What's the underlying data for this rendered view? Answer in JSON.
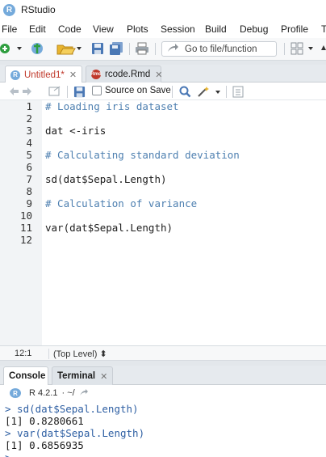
{
  "window": {
    "title": "RStudio",
    "logo_letter": "R"
  },
  "menu": [
    "File",
    "Edit",
    "Code",
    "View",
    "Plots",
    "Session",
    "Build",
    "Debug",
    "Profile",
    "T"
  ],
  "toolbar": {
    "goto_placeholder": "Go to file/function",
    "icons": [
      "new-file-icon",
      "open-project-icon",
      "open-file-icon",
      "save-icon",
      "save-all-icon",
      "print-icon",
      "goto-arrow-icon",
      "grid-layout-icon"
    ]
  },
  "editor_tabs": [
    {
      "label": "Untitled1*",
      "icon": "r-file-icon",
      "active": true,
      "modified": true
    },
    {
      "label": "rcode.Rmd",
      "icon": "rmd-file-icon",
      "active": false,
      "modified": false
    }
  ],
  "editor_toolbar": {
    "source_on_save_label": "Source on Save",
    "source_on_save_checked": false
  },
  "code_lines": [
    {
      "num": "1",
      "text": "# Loading iris dataset",
      "type": "comment"
    },
    {
      "num": "2",
      "text": "",
      "type": "code"
    },
    {
      "num": "3",
      "text": "dat <-iris",
      "type": "code"
    },
    {
      "num": "4",
      "text": "",
      "type": "code"
    },
    {
      "num": "5",
      "text": "# Calculating standard deviation",
      "type": "comment"
    },
    {
      "num": "6",
      "text": "",
      "type": "code"
    },
    {
      "num": "7",
      "text": "sd(dat$Sepal.Length)",
      "type": "code"
    },
    {
      "num": "8",
      "text": "",
      "type": "code"
    },
    {
      "num": "9",
      "text": "# Calculation of variance",
      "type": "comment"
    },
    {
      "num": "10",
      "text": "",
      "type": "code"
    },
    {
      "num": "11",
      "text": "var(dat$Sepal.Length)",
      "type": "code"
    },
    {
      "num": "12",
      "text": "",
      "type": "code"
    }
  ],
  "status": {
    "cursor": "12:1",
    "scope": "(Top Level)",
    "scope_arrow": "⬍"
  },
  "console_tabs": [
    {
      "label": "Console",
      "active": true,
      "closable": false
    },
    {
      "label": "Terminal",
      "active": false,
      "closable": true
    }
  ],
  "console_header": {
    "r_version": "R 4.2.1",
    "path": "· ~/"
  },
  "console_lines": [
    {
      "text": "> sd(dat$Sepal.Length)",
      "type": "input"
    },
    {
      "text": "[1] 0.8280661",
      "type": "output"
    },
    {
      "text": "> var(dat$Sepal.Length)",
      "type": "input"
    },
    {
      "text": "[1] 0.6856935",
      "type": "output"
    },
    {
      "text": "> ",
      "type": "input"
    }
  ]
}
